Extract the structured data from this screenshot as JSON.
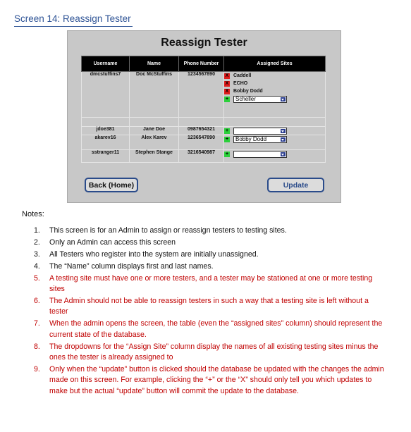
{
  "heading": "Screen 14: Reassign Tester",
  "mockup": {
    "title": "Reassign Tester",
    "columns": [
      "Username",
      "Name",
      "Phone Number",
      "Assigned Sites"
    ],
    "rows": [
      {
        "username": "dmcstuffins7",
        "name": "Doc McStuffins",
        "phone": "1234567890",
        "sites": [
          "Caddell",
          "ECHO",
          "Bobby Dodd"
        ],
        "dropdown": "Scheller"
      },
      {
        "username": "jdoe381",
        "name": "Jane Doe",
        "phone": "0987654321",
        "sites": [],
        "dropdown": ""
      },
      {
        "username": "akarev16",
        "name": "Alex Karev",
        "phone": "1236547890",
        "sites": [],
        "dropdown": "Bobby Dodd"
      },
      {
        "username": "sstranger11",
        "name": "Stephen Stange",
        "phone": "3216540987",
        "sites": [],
        "dropdown": ""
      }
    ],
    "remove_symbol": "X",
    "add_symbol": "+",
    "back_label": "Back (Home)",
    "update_label": "Update"
  },
  "notes_label": "Notes:",
  "notes": [
    {
      "num": "1.",
      "text": "This screen is for an Admin to assign or reassign testers to testing sites.",
      "color": "#111111"
    },
    {
      "num": "2.",
      "text": "Only an Admin can access this screen",
      "color": "#111111"
    },
    {
      "num": "3.",
      "text": "All Testers who register into the system are initially unassigned.",
      "color": "#111111"
    },
    {
      "num": "4.",
      "text": "The “Name” column displays first and last names.",
      "color": "#111111"
    },
    {
      "num": "5.",
      "text": "A testing site must have one or more testers, and a tester may be stationed at one or more testing sites",
      "color": "#c00000"
    },
    {
      "num": "6.",
      "text": "The Admin should not be able to reassign testers in such a way that a testing site is left without a tester",
      "color": "#c00000"
    },
    {
      "num": "7.",
      "text": "When the admin opens the screen, the table (even the “assigned sites” column) should represent the current state of the database.",
      "color": "#c00000"
    },
    {
      "num": "8.",
      "text": "The dropdowns for the “Assign Site” column display the names of all existing testing sites minus the ones the tester is already assigned to",
      "color": "#c00000"
    },
    {
      "num": "9.",
      "text": "Only when the “update” button is clicked should the database be updated with the changes the admin made on this screen. For example, clicking the “+” or the “X” should only tell you which updates to make but the actual “update” button will commit the update to the database.",
      "color": "#c00000"
    }
  ]
}
